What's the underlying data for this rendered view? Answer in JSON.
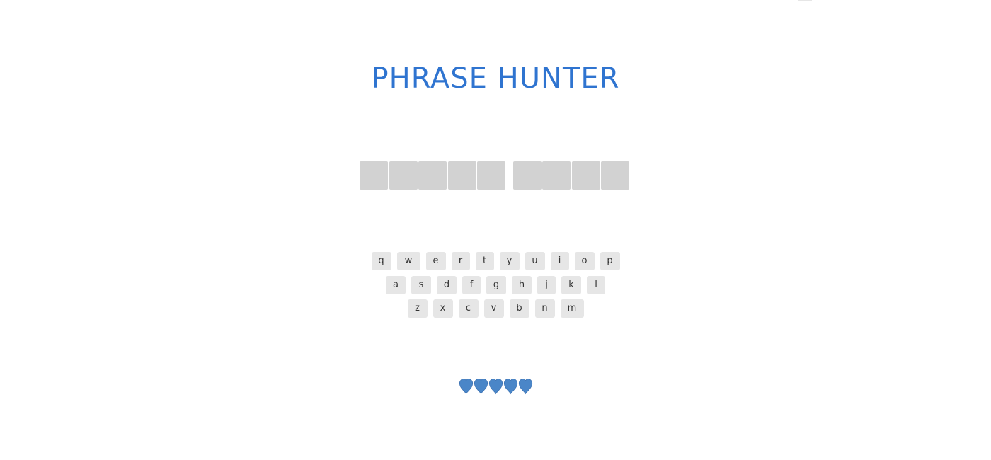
{
  "header": {
    "title": "PHRASE HUNTER"
  },
  "phrase": {
    "words": [
      {
        "letters": 5
      },
      {
        "letters": 4
      }
    ]
  },
  "keyboard": {
    "rows": [
      [
        "q",
        "w",
        "e",
        "r",
        "t",
        "y",
        "u",
        "i",
        "o",
        "p"
      ],
      [
        "a",
        "s",
        "d",
        "f",
        "g",
        "h",
        "j",
        "k",
        "l"
      ],
      [
        "z",
        "x",
        "c",
        "v",
        "b",
        "n",
        "m"
      ]
    ]
  },
  "scoreboard": {
    "lives_remaining": 5,
    "icon": "heart-icon"
  },
  "colors": {
    "title": "#2f74d0",
    "tile": "#d2d2d2",
    "key": "#e6e6e6",
    "key_text": "#333333",
    "heart": "#4a86c8"
  }
}
